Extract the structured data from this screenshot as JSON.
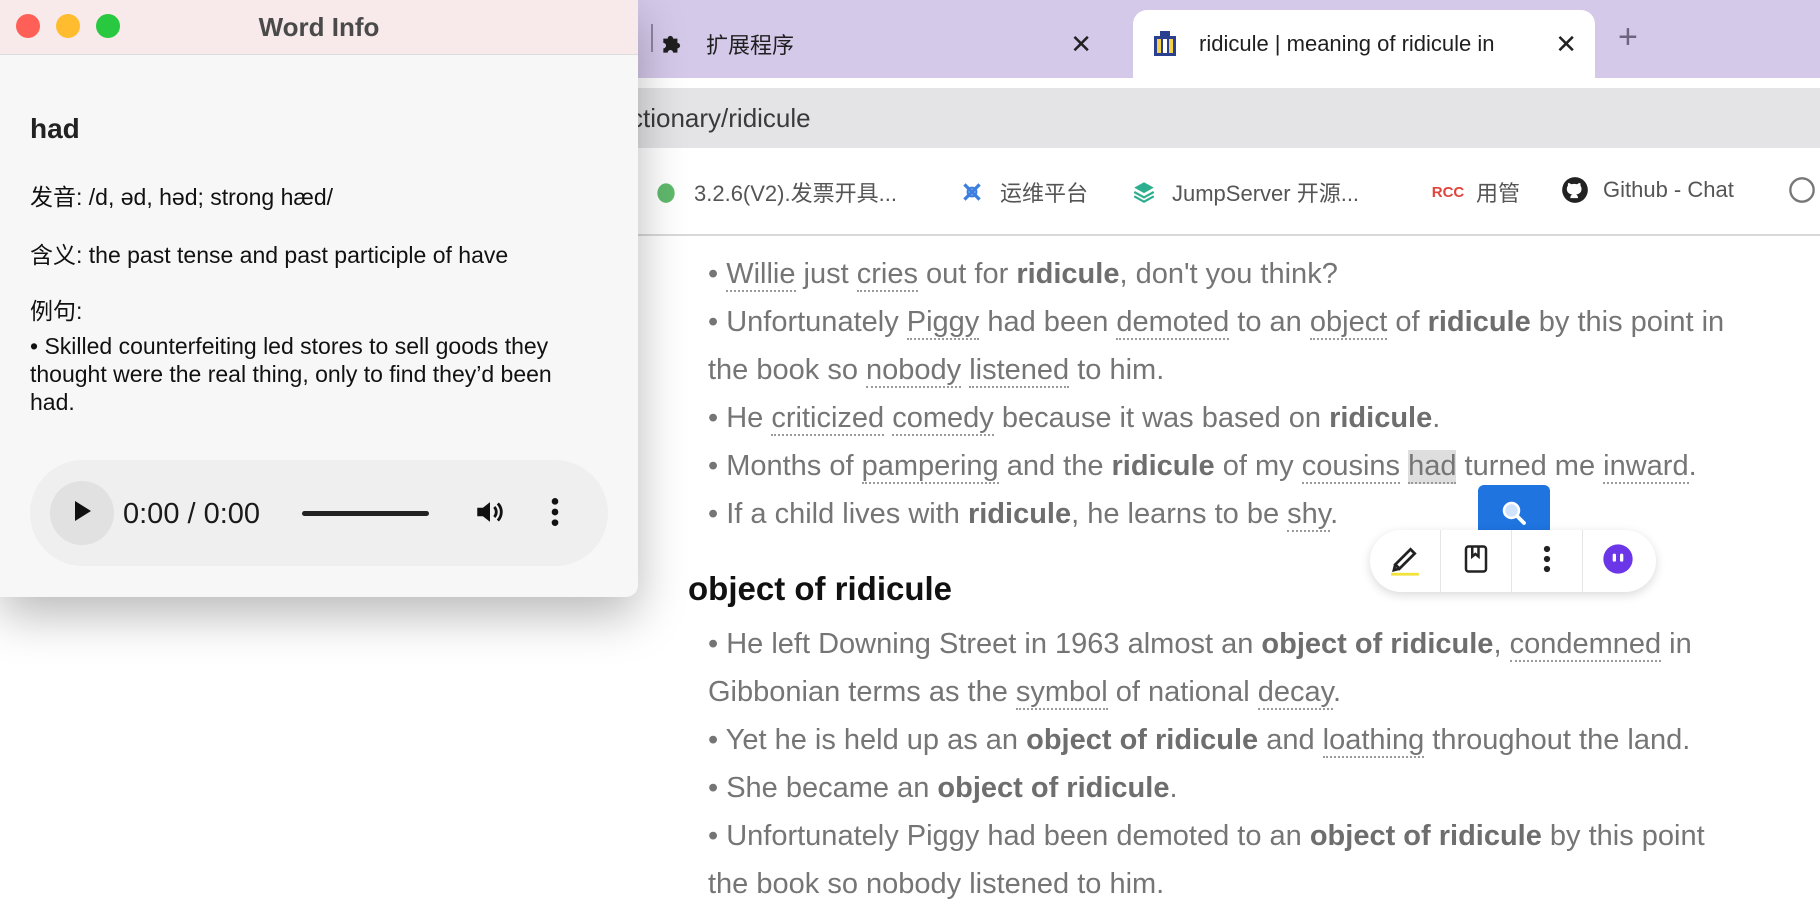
{
  "browser": {
    "tabs": [
      {
        "label": "扩展程序",
        "icon": "puzzle-icon",
        "active": false
      },
      {
        "label": "ridicule | meaning of ridicule in",
        "icon": "site-logo-icon",
        "active": true
      }
    ],
    "url": "ctionary/ridicule",
    "bookmarks": [
      {
        "label": "3.2.6(V2).发票开具...",
        "icon": "leaf-icon"
      },
      {
        "label": "运维平台",
        "icon": "network-icon"
      },
      {
        "label": "JumpServer 开源...",
        "icon": "layers-icon"
      },
      {
        "label": "用管",
        "icon": "rcc-icon"
      },
      {
        "label": "Github - Chat",
        "icon": "github-icon"
      }
    ]
  },
  "examples_top": [
    "• Willie just cries out for ridicule, don't you think?",
    "• Unfortunately Piggy had been demoted to an object of ridicule by this point in",
    "the book so nobody listened to him.",
    "• He criticized comedy because it was based on ridicule.",
    "• Months of pampering and the ridicule of my cousins had turned me inward.",
    "• If a child lives with ridicule, he learns to be shy."
  ],
  "section_heading": "object of ridicule",
  "examples_bottom": [
    "• He left Downing Street in 1963 almost an object of ridicule, condemned in",
    "Gibbonian terms as the symbol of national decay.",
    "• Yet he is held up as an object of ridicule and loathing throughout the land.",
    "• She became an object of ridicule.",
    "• Unfortunately Piggy had been demoted to an object of ridicule by this point",
    "the book so nobody listened to him."
  ],
  "popup": {
    "title": "Word Info",
    "word": "had",
    "pronunciation": "发音: /d, əd, həd; strong hæd/",
    "meaning": "含义: the past tense and past participle of have",
    "examples_label": "例句:",
    "example_text": "• Skilled counterfeiting led stores to sell goods they thought were the real thing, only to find they’d been had.",
    "audio_time": "0:00 / 0:00"
  },
  "colors": {
    "tabbar": "#d5c9ea",
    "accent_blue": "#1f74e0",
    "close_red": "#fe5f57",
    "minimize_yellow": "#febc2e",
    "zoom_green": "#28c840"
  }
}
